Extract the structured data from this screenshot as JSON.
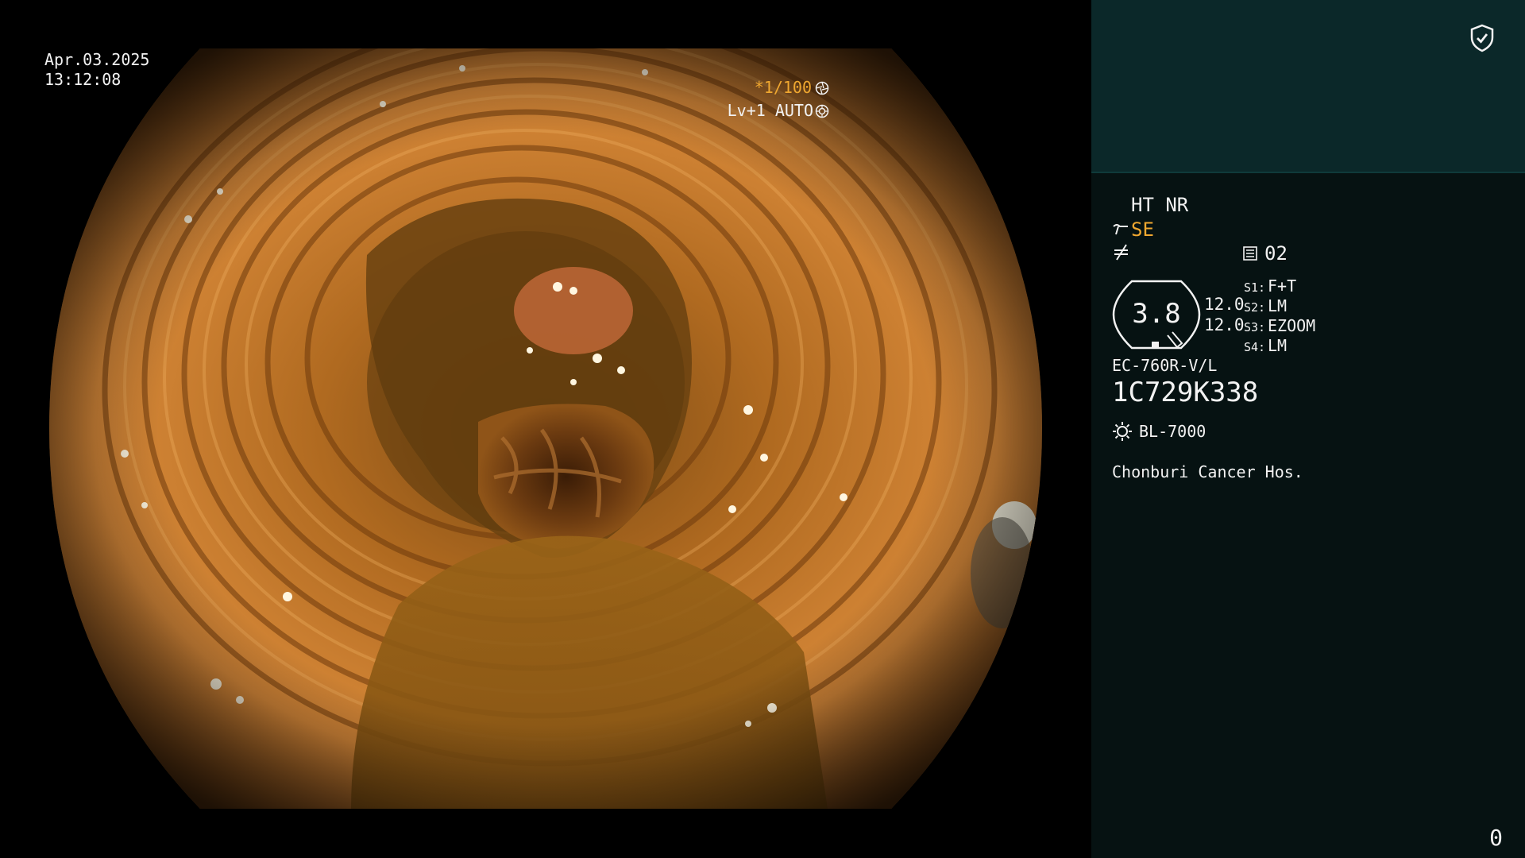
{
  "video": {
    "date": "Apr.03.2025",
    "time": "13:12:08",
    "shutter": "*1/100",
    "shutter_icon": "shutter-icon",
    "iris": "Lv+1 AUTO",
    "iris_icon": "iris-icon"
  },
  "panel": {
    "ht_nr": "HT NR",
    "se": "SE",
    "mode_number": "02",
    "gauge_value": "3.8",
    "level1": "12.0",
    "level2": "12.0",
    "switches": [
      {
        "key": "S1:",
        "value": "F+T"
      },
      {
        "key": "S2:",
        "value": "LM"
      },
      {
        "key": "S3:",
        "value": "EZOOM"
      },
      {
        "key": "S4:",
        "value": "LM"
      }
    ],
    "scope_model": "EC-760R-V/L",
    "serial": "1C729K338",
    "light_source": "BL-7000",
    "hospital": "Chonburi Cancer Hos.",
    "counter": "0"
  },
  "colors": {
    "accent_orange": "#f0a830",
    "panel_top": "#0b2829",
    "panel_bg": "#061212"
  }
}
